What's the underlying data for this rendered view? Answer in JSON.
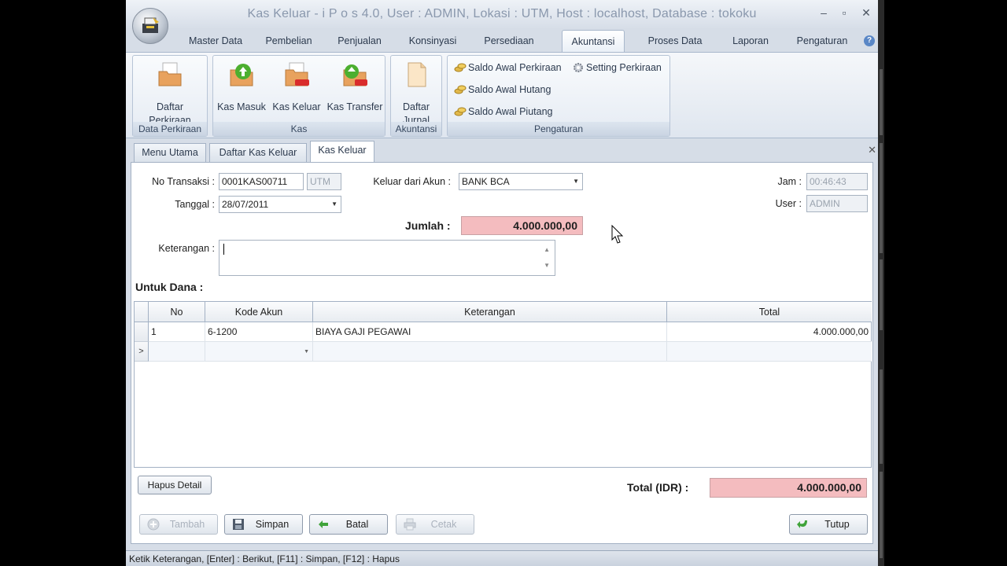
{
  "window": {
    "title": "Kas Keluar - i P o s 4.0,  User : ADMIN, Lokasi : UTM, Host : localhost, Database : tokoku",
    "min": "–",
    "max": "▫",
    "close": "✕"
  },
  "ribbon_tabs": [
    {
      "label": "Master Data"
    },
    {
      "label": "Pembelian"
    },
    {
      "label": "Penjualan"
    },
    {
      "label": "Konsinyasi"
    },
    {
      "label": "Persediaan"
    },
    {
      "label": "Akuntansi",
      "active": true
    },
    {
      "label": "Proses Data"
    },
    {
      "label": "Laporan"
    },
    {
      "label": "Pengaturan"
    }
  ],
  "ribbon": {
    "data_perkiraan": {
      "label": "Data Perkiraan",
      "btn_line1": "Daftar",
      "btn_line2": "Perkiraan"
    },
    "kas": {
      "label": "Kas",
      "kas_masuk": "Kas Masuk",
      "kas_keluar": "Kas Keluar",
      "kas_transfer": "Kas Transfer"
    },
    "akuntansi": {
      "label": "Akuntansi",
      "btn_line1": "Daftar",
      "btn_line2": "Jurnal"
    },
    "pengaturan": {
      "label": "Pengaturan",
      "saldo_awal_perkiraan": "Saldo Awal Perkiraan",
      "setting_perkiraan": "Setting Perkiraan",
      "saldo_awal_hutang": "Saldo Awal Hutang",
      "saldo_awal_piutang": "Saldo Awal Piutang"
    }
  },
  "doc_tabs": [
    {
      "label": "Menu Utama"
    },
    {
      "label": "Daftar Kas Keluar"
    },
    {
      "label": "Kas Keluar",
      "active": true
    }
  ],
  "form": {
    "no_transaksi_label": "No Transaksi :",
    "no_transaksi_value": "0001KAS00711",
    "lokasi_value": "UTM",
    "tanggal_label": "Tanggal :",
    "tanggal_value": "28/07/2011",
    "keluar_label": "Keluar dari Akun :",
    "keluar_value": "BANK BCA",
    "jam_label": "Jam :",
    "jam_value": "00:46:43",
    "user_label": "User :",
    "user_value": "ADMIN",
    "jumlah_label": "Jumlah :",
    "jumlah_value": "4.000.000,00",
    "keterangan_label": "Keterangan :",
    "keterangan_value": "",
    "untuk_dana_label": "Untuk Dana :"
  },
  "grid": {
    "columns": [
      "No",
      "Kode Akun",
      "Keterangan",
      "Total"
    ],
    "rows": [
      {
        "no": "1",
        "kode": "6-1200",
        "keterangan": "BIAYA GAJI PEGAWAI",
        "total": "4.000.000,00"
      }
    ],
    "new_row_marker": ">"
  },
  "footer": {
    "hapus_detail": "Hapus Detail",
    "total_label": "Total (IDR) :",
    "total_value": "4.000.000,00",
    "tambah": "Tambah",
    "simpan": "Simpan",
    "batal": "Batal",
    "cetak": "Cetak",
    "tutup": "Tutup"
  },
  "status_text": "Ketik Keterangan, [Enter] : Berikut, [F11] : Simpan, [F12] : Hapus"
}
